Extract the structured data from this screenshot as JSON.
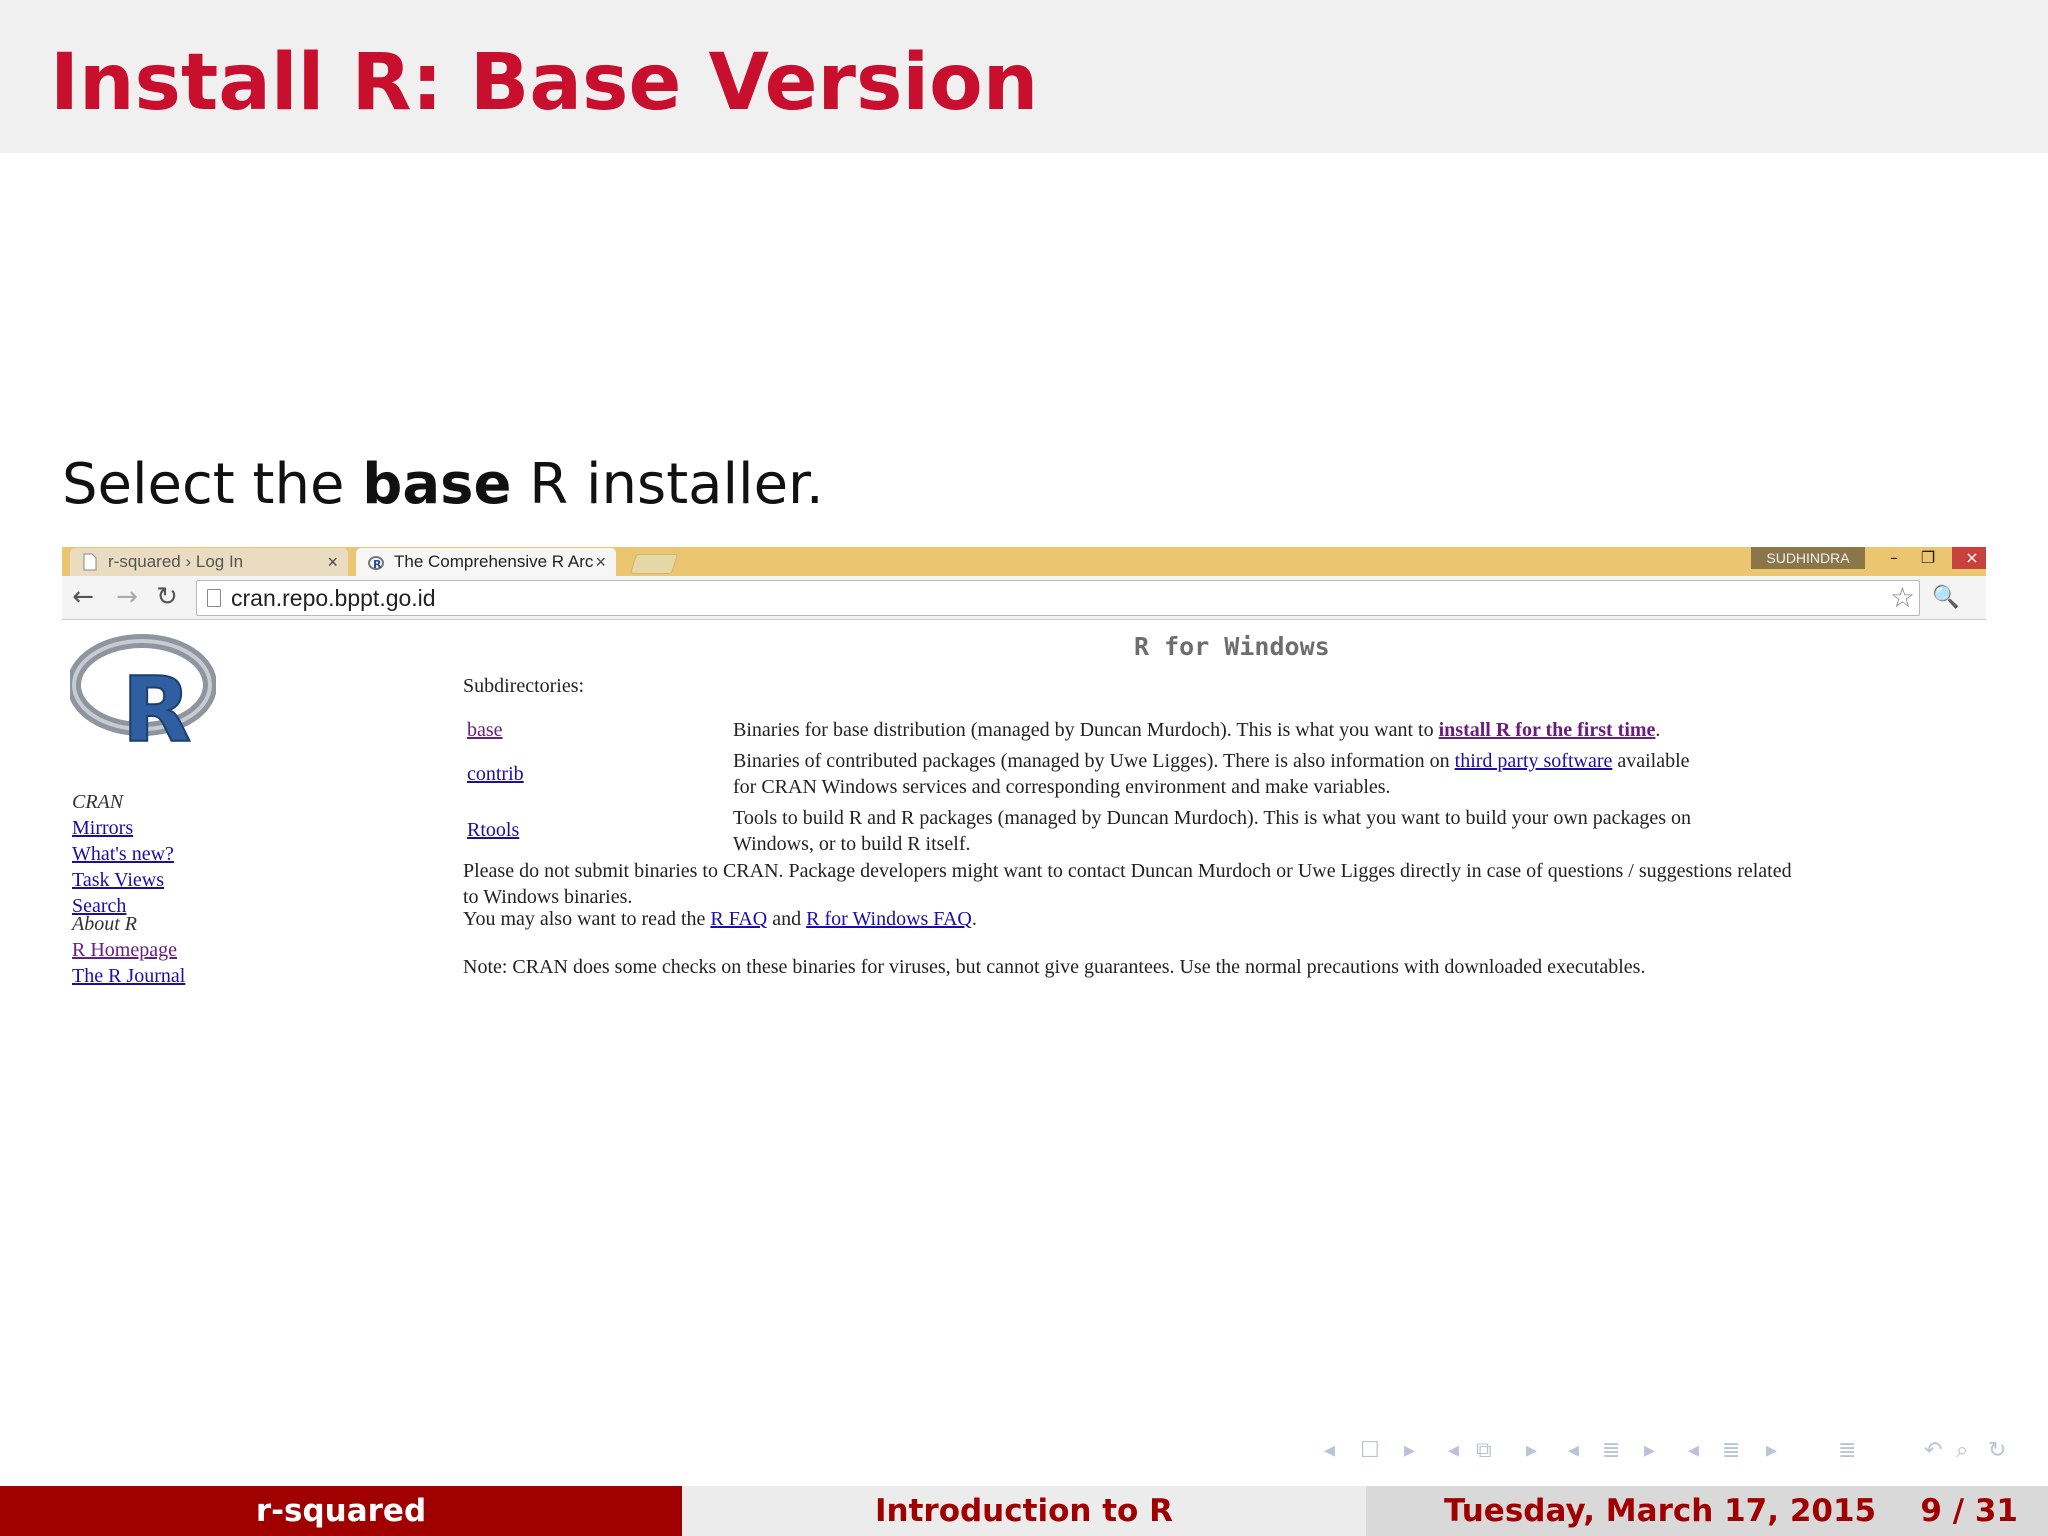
{
  "slide": {
    "title": "Install R: Base Version",
    "intro_pre": "Select the ",
    "intro_bold": "base",
    "intro_post": " R installer."
  },
  "browser": {
    "tabs": [
      {
        "label": "r-squared › Log In",
        "close": "×"
      },
      {
        "label": "The Comprehensive R Arc",
        "close": "×"
      }
    ],
    "user": "SUDHINDRA",
    "window_buttons": {
      "minimize": "–",
      "restore": "❐",
      "close": "×"
    },
    "url": "cran.repo.bppt.go.id",
    "icons": {
      "back": "back-arrow-icon",
      "forward": "forward-arrow-icon",
      "reload": "reload-icon",
      "star": "star-icon",
      "extension": "extension-icon"
    }
  },
  "cran": {
    "logo_letter": "R",
    "sidebar": {
      "cran_heading": "CRAN",
      "cran_links": [
        "Mirrors",
        "What's new?",
        "Task Views",
        "Search"
      ],
      "about_heading": "About R",
      "about_links": [
        "R Homepage",
        "The R Journal"
      ]
    },
    "title": "R for Windows",
    "subdirectories_label": "Subdirectories:",
    "rows": [
      {
        "link": "base",
        "desc_pre": "Binaries for base distribution (managed by Duncan Murdoch). This is what you want to ",
        "desc_link": "install R for the first time",
        "desc_post": "."
      },
      {
        "link": "contrib",
        "desc_pre": "Binaries of contributed packages (managed by Uwe Ligges). There is also information on ",
        "desc_link": "third party software",
        "desc_post": " available",
        "desc_line2": "for CRAN Windows services and corresponding environment and make variables."
      },
      {
        "link": "Rtools",
        "desc_line1": "Tools to build R and R packages (managed by Duncan Murdoch). This is what you want to build your own packages on",
        "desc_line2": "Windows, or to build R itself."
      }
    ],
    "para1_line1": "Please do not submit binaries to CRAN. Package developers might want to contact Duncan Murdoch or Uwe Ligges directly in case of questions / suggestions related",
    "para1_line2": "to Windows binaries.",
    "para2_pre": "You may also want to read the ",
    "para2_link1": "R FAQ",
    "para2_mid": " and ",
    "para2_link2": "R for Windows FAQ",
    "para2_post": ".",
    "para3": "Note: CRAN does some checks on these binaries for viruses, but cannot give guarantees. Use the normal precautions with downloaded executables."
  },
  "beamer_nav": {
    "symbols": [
      "◂",
      "☐",
      "▸",
      "◂",
      "⧉",
      "▸",
      "◂",
      "≣",
      "▸",
      "◂",
      "≣",
      "▸",
      "≣",
      "↶",
      "⌕",
      "↻"
    ]
  },
  "footer": {
    "left": "r-squared",
    "center": "Introduction to R",
    "date": "Tuesday, March 17, 2015",
    "page": "9 / 31"
  }
}
